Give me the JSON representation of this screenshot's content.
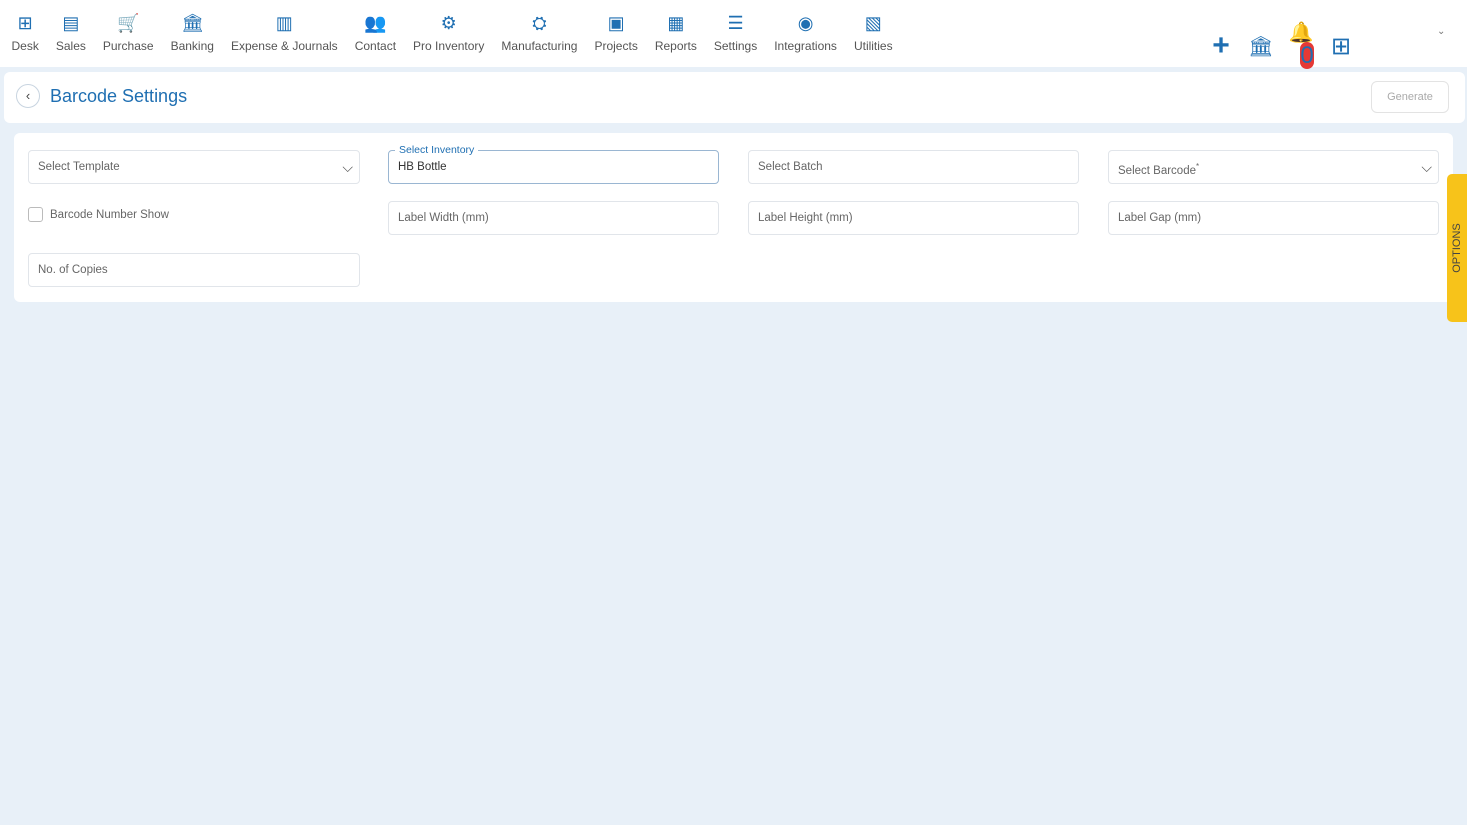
{
  "nav": {
    "items": [
      {
        "label": "Desk",
        "icon": "desk-icon",
        "glyph": "⊞"
      },
      {
        "label": "Sales",
        "icon": "sales-icon",
        "glyph": "▤"
      },
      {
        "label": "Purchase",
        "icon": "cart-icon",
        "glyph": "🛒"
      },
      {
        "label": "Banking",
        "icon": "bank-icon",
        "glyph": "🏛"
      },
      {
        "label": "Expense & Journals",
        "icon": "journal-icon",
        "glyph": "▥"
      },
      {
        "label": "Contact",
        "icon": "contact-icon",
        "glyph": "👥"
      },
      {
        "label": "Pro Inventory",
        "icon": "inventory-icon",
        "glyph": "⚙"
      },
      {
        "label": "Manufacturing",
        "icon": "manufacturing-icon",
        "glyph": "⛭"
      },
      {
        "label": "Projects",
        "icon": "projects-icon",
        "glyph": "▣"
      },
      {
        "label": "Reports",
        "icon": "reports-icon",
        "glyph": "▦"
      },
      {
        "label": "Settings",
        "icon": "settings-icon",
        "glyph": "☰"
      },
      {
        "label": "Integrations",
        "icon": "integrations-icon",
        "glyph": "◉"
      },
      {
        "label": "Utilities",
        "icon": "utilities-icon",
        "glyph": "▧"
      }
    ]
  },
  "topright": {
    "add": "+",
    "bank_transfer": "🏛",
    "notifications_count": "0",
    "bell": "🔔",
    "apps": "⊞",
    "caret": "⌄"
  },
  "header": {
    "back": "‹",
    "title": "Barcode Settings",
    "generate": "Generate"
  },
  "form": {
    "template": {
      "placeholder": "Select Template"
    },
    "inventory": {
      "label": "Select Inventory",
      "value": "HB Bottle"
    },
    "batch": {
      "placeholder": "Select Batch"
    },
    "barcode": {
      "placeholder": "Select Barcode",
      "required": "*"
    },
    "barcode_number_show": {
      "label": "Barcode Number Show",
      "checked": false
    },
    "label_width": {
      "placeholder": "Label Width (mm)"
    },
    "label_height": {
      "placeholder": "Label Height (mm)"
    },
    "label_gap": {
      "placeholder": "Label Gap (mm)"
    },
    "copies": {
      "placeholder": "No. of Copies"
    }
  },
  "options_tab": "OPTIONS",
  "colors": {
    "accent": "#1f6fb2",
    "options": "#f7c31a",
    "background": "#e8f0f8"
  }
}
